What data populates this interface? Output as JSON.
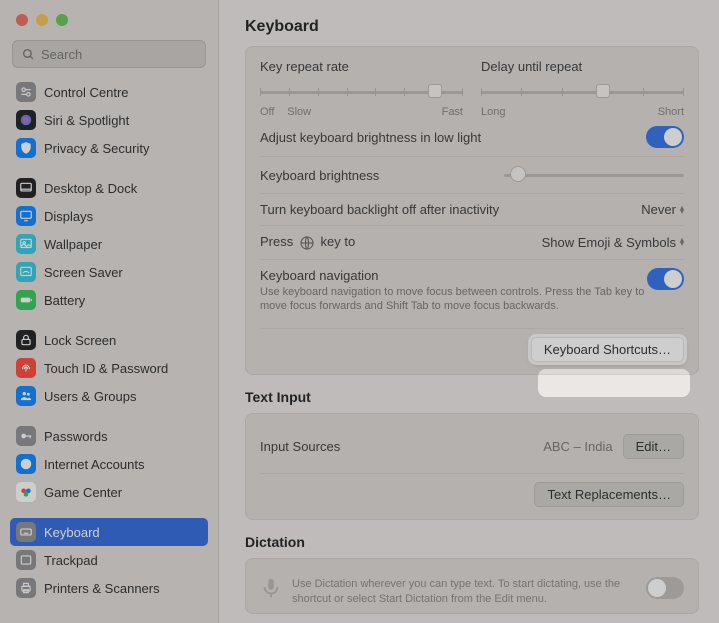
{
  "search": {
    "placeholder": "Search"
  },
  "sidebar": {
    "items": [
      {
        "label": "Control Centre",
        "icon": "control-centre-icon",
        "bg": "#8e8e93"
      },
      {
        "label": "Siri & Spotlight",
        "icon": "siri-icon",
        "bg": "#1c1c1e"
      },
      {
        "label": "Privacy & Security",
        "icon": "privacy-icon",
        "bg": "#0a84ff"
      },
      {
        "gap": true
      },
      {
        "label": "Desktop & Dock",
        "icon": "desktop-dock-icon",
        "bg": "#1c1c1e"
      },
      {
        "label": "Displays",
        "icon": "displays-icon",
        "bg": "#0a84ff"
      },
      {
        "label": "Wallpaper",
        "icon": "wallpaper-icon",
        "bg": "#34c7e0"
      },
      {
        "label": "Screen Saver",
        "icon": "screen-saver-icon",
        "bg": "#34c7e0"
      },
      {
        "label": "Battery",
        "icon": "battery-icon",
        "bg": "#34c759"
      },
      {
        "gap": true
      },
      {
        "label": "Lock Screen",
        "icon": "lock-screen-icon",
        "bg": "#1c1c1e"
      },
      {
        "label": "Touch ID & Password",
        "icon": "touch-id-icon",
        "bg": "#ff453a"
      },
      {
        "label": "Users & Groups",
        "icon": "users-groups-icon",
        "bg": "#0a84ff"
      },
      {
        "gap": true
      },
      {
        "label": "Passwords",
        "icon": "passwords-icon",
        "bg": "#8e8e93"
      },
      {
        "label": "Internet Accounts",
        "icon": "internet-accounts-icon",
        "bg": "#0a84ff"
      },
      {
        "label": "Game Center",
        "icon": "game-center-icon",
        "bg": "#ffffff"
      },
      {
        "gap": true
      },
      {
        "label": "Keyboard",
        "icon": "keyboard-icon",
        "bg": "#8e8e93",
        "selected": true
      },
      {
        "label": "Trackpad",
        "icon": "trackpad-icon",
        "bg": "#8e8e93"
      },
      {
        "label": "Printers & Scanners",
        "icon": "printers-icon",
        "bg": "#8e8e93"
      }
    ]
  },
  "main": {
    "title": "Keyboard",
    "key_repeat_label": "Key repeat rate",
    "key_repeat_ticks": {
      "off": "Off",
      "slow": "Slow",
      "fast": "Fast"
    },
    "delay_label": "Delay until repeat",
    "delay_ticks": {
      "long": "Long",
      "short": "Short"
    },
    "brightness_auto_label": "Adjust keyboard brightness in low light",
    "brightness_label": "Keyboard brightness",
    "backlight_off_label": "Turn keyboard backlight off after inactivity",
    "backlight_off_value": "Never",
    "press_globe_pre": "Press",
    "press_globe_post": "key to",
    "press_globe_value": "Show Emoji & Symbols",
    "kb_nav_label": "Keyboard navigation",
    "kb_nav_sub": "Use keyboard navigation to move focus between controls. Press the Tab key to move focus forwards and Shift Tab to move focus backwards.",
    "kb_shortcuts_btn": "Keyboard Shortcuts…",
    "text_input_heading": "Text Input",
    "input_sources_label": "Input Sources",
    "input_sources_value": "ABC – India",
    "input_sources_edit": "Edit…",
    "text_replacements_btn": "Text Replacements…",
    "dictation_heading": "Dictation",
    "dictation_sub": "Use Dictation wherever you can type text. To start dictating, use the shortcut or select Start Dictation from the Edit menu."
  }
}
